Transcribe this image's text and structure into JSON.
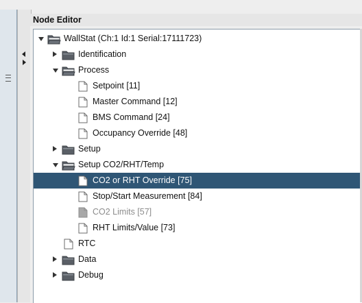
{
  "panel": {
    "title": "Node Editor"
  },
  "tree": {
    "items": [
      {
        "label": "WallStat (Ch:1 Id:1 Serial:17111723)",
        "icon": "folder-open-icon",
        "toggle": "expanded",
        "level": 0,
        "selected": false,
        "disabled": false
      },
      {
        "label": "Identification",
        "icon": "folder-closed-icon",
        "toggle": "collapsed",
        "level": 1,
        "selected": false,
        "disabled": false
      },
      {
        "label": "Process",
        "icon": "folder-open-icon",
        "toggle": "expanded",
        "level": 1,
        "selected": false,
        "disabled": false
      },
      {
        "label": "Setpoint [11]",
        "icon": "file-icon",
        "toggle": "none",
        "level": 2,
        "selected": false,
        "disabled": false
      },
      {
        "label": "Master Command [12]",
        "icon": "file-icon",
        "toggle": "none",
        "level": 2,
        "selected": false,
        "disabled": false
      },
      {
        "label": "BMS Command [24]",
        "icon": "file-icon",
        "toggle": "none",
        "level": 2,
        "selected": false,
        "disabled": false
      },
      {
        "label": "Occupancy Override [48]",
        "icon": "file-icon",
        "toggle": "none",
        "level": 2,
        "selected": false,
        "disabled": false
      },
      {
        "label": "Setup",
        "icon": "folder-closed-icon",
        "toggle": "collapsed",
        "level": 1,
        "selected": false,
        "disabled": false
      },
      {
        "label": "Setup CO2/RHT/Temp",
        "icon": "folder-open-icon",
        "toggle": "expanded",
        "level": 1,
        "selected": false,
        "disabled": false
      },
      {
        "label": "CO2 or RHT Override [75]",
        "icon": "file-icon",
        "toggle": "none",
        "level": 2,
        "selected": true,
        "disabled": false
      },
      {
        "label": "Stop/Start Measurement [84]",
        "icon": "file-icon",
        "toggle": "none",
        "level": 2,
        "selected": false,
        "disabled": false
      },
      {
        "label": "CO2 Limits [57]",
        "icon": "file-disabled-icon",
        "toggle": "none",
        "level": 2,
        "selected": false,
        "disabled": true
      },
      {
        "label": "RHT Limits/Value [73]",
        "icon": "file-icon",
        "toggle": "none",
        "level": 2,
        "selected": false,
        "disabled": false
      },
      {
        "label": "RTC",
        "icon": "file-icon",
        "toggle": "none",
        "level": 1,
        "selected": false,
        "disabled": false
      },
      {
        "label": "Data",
        "icon": "folder-closed-icon",
        "toggle": "collapsed",
        "level": 1,
        "selected": false,
        "disabled": false
      },
      {
        "label": "Debug",
        "icon": "folder-closed-icon",
        "toggle": "collapsed",
        "level": 1,
        "selected": false,
        "disabled": false
      }
    ]
  },
  "colors": {
    "selection": "#2f5675",
    "folder": "#5a5f66",
    "file_border": "#6b6b6b",
    "disabled_text": "#8c8c8c"
  }
}
